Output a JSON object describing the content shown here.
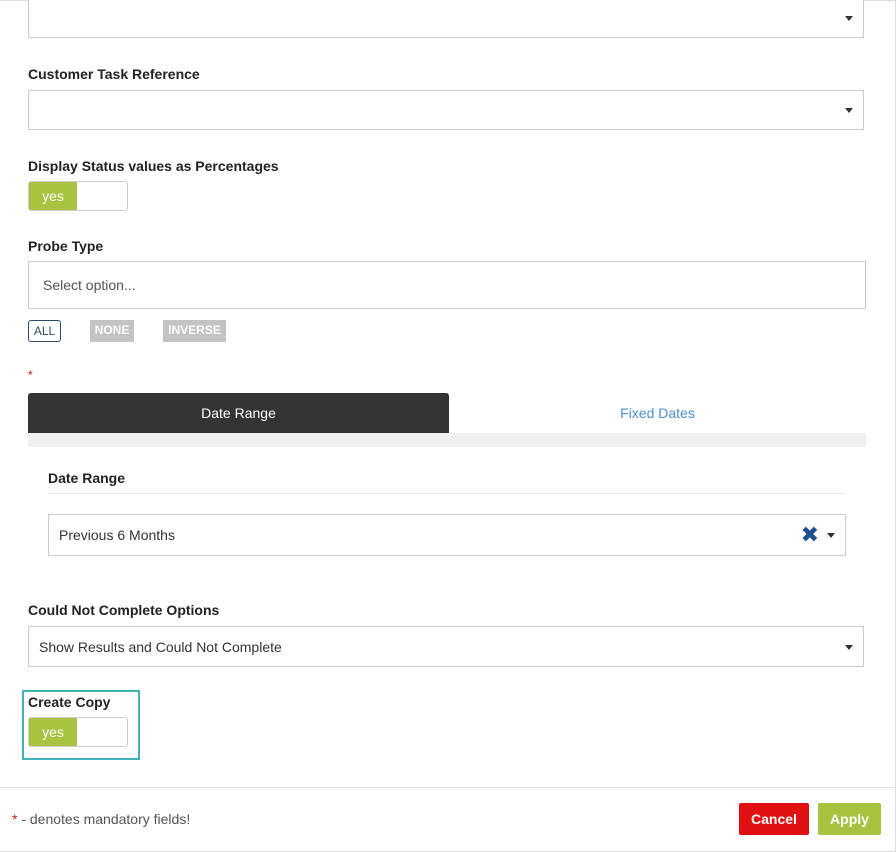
{
  "fields": {
    "top_select": {
      "value": ""
    },
    "customer_task_reference": {
      "label": "Customer Task Reference",
      "value": ""
    },
    "display_status_percentages": {
      "label": "Display Status values as Percentages",
      "toggle_label": "yes",
      "state": "on"
    },
    "probe_type": {
      "label": "Probe Type",
      "placeholder": "Select option...",
      "chips": {
        "all": "ALL",
        "none": "NONE",
        "inverse": "INVERSE"
      }
    },
    "mandatory_marker": "*",
    "date_tabs": {
      "active": "Date Range",
      "inactive": "Fixed Dates"
    },
    "date_range": {
      "label": "Date Range",
      "value": "Previous 6 Months",
      "clear_icon": "close-icon"
    },
    "could_not_complete": {
      "label": "Could Not Complete Options",
      "value": "Show Results and Could Not Complete"
    },
    "create_copy": {
      "label": "Create Copy",
      "toggle_label": "yes",
      "state": "on"
    }
  },
  "footer": {
    "asterisk": "*",
    "note": " - denotes mandatory fields!",
    "cancel_label": "Cancel",
    "apply_label": "Apply"
  },
  "colors": {
    "toggle_on": "#a9c23f",
    "active_tab": "#333333",
    "inactive_tab_text": "#4a8fd6",
    "cancel": "#e00f12",
    "apply": "#a9c23f",
    "highlight_border": "#3fb3b8",
    "mandatory": "#d9141e"
  }
}
